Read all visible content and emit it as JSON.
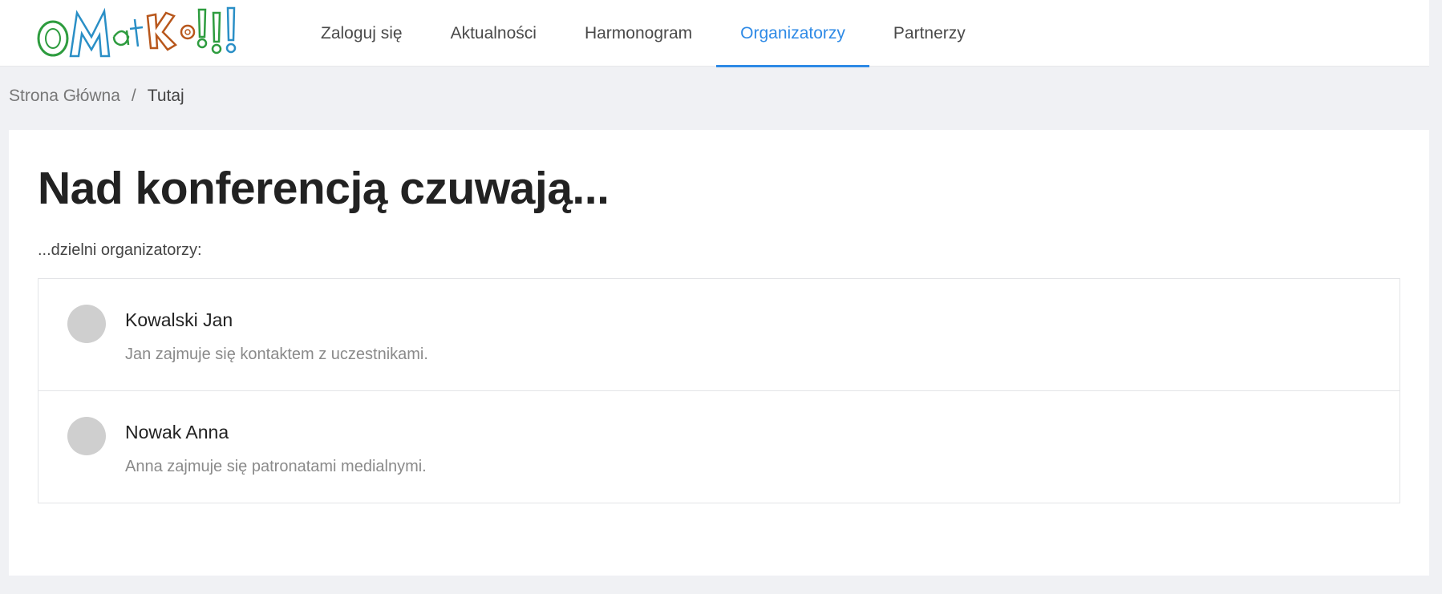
{
  "logo": {
    "text": "OMatKo!!!",
    "colors": [
      "#2e9c3f",
      "#2a8fc6",
      "#b8571c",
      "#2e9c3f"
    ]
  },
  "nav": {
    "items": [
      {
        "label": "Zaloguj się"
      },
      {
        "label": "Aktualności"
      },
      {
        "label": "Harmonogram"
      },
      {
        "label": "Organizatorzy"
      },
      {
        "label": "Partnerzy"
      }
    ],
    "active": "Organizatorzy"
  },
  "breadcrumb": {
    "home": "Strona Główna",
    "separator": "/",
    "current": "Tutaj"
  },
  "main": {
    "title": "Nad konferencją czuwają...",
    "subtitle": "...dzielni organizatorzy:",
    "organizers": [
      {
        "name": "Kowalski Jan",
        "description": "Jan zajmuje się kontaktem z uczestnikami."
      },
      {
        "name": "Nowak Anna",
        "description": "Anna zajmuje się patronatami medialnymi."
      }
    ]
  },
  "colors": {
    "accent": "#2e8ae6",
    "background": "#f0f1f4",
    "avatar": "#cfcfcf"
  }
}
